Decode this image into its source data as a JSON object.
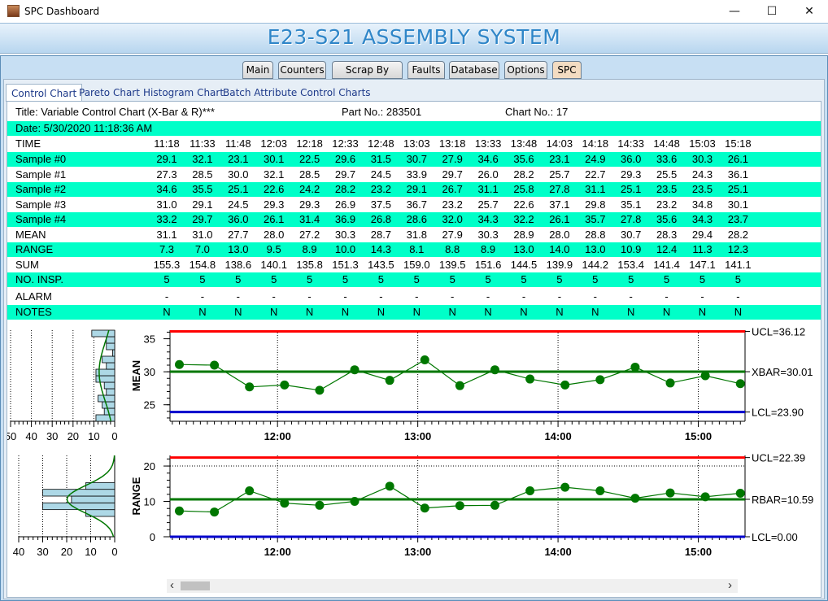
{
  "window": {
    "title": "SPC Dashboard",
    "minimize_glyph": "—",
    "maximize_glyph": "☐",
    "close_glyph": "✕"
  },
  "banner": {
    "title": "E23-S21 ASSEMBLY SYSTEM"
  },
  "main_tabs": [
    "Main",
    "Counters",
    "Scrap By Pallet",
    "Faults",
    "Database",
    "Options",
    "SPC"
  ],
  "main_tab_active": "SPC",
  "sub_tabs": [
    "Control Chart",
    "Pareto Chart",
    "Histogram Chart",
    "Batch Attribute Control Charts"
  ],
  "sub_tab_active": "Control Chart",
  "header": {
    "title": "Title: Variable Control Chart (X-Bar & R)***",
    "part_no": "Part No.: 283501",
    "chart_no": "Chart No.: 17",
    "date": "Date: 5/30/2020 11:18:36 AM"
  },
  "table": {
    "times": [
      "11:18",
      "11:33",
      "11:48",
      "12:03",
      "12:18",
      "12:33",
      "12:48",
      "13:03",
      "13:18",
      "13:33",
      "13:48",
      "14:03",
      "14:18",
      "14:33",
      "14:48",
      "15:03",
      "15:18"
    ],
    "rows": [
      {
        "label": "TIME",
        "key": "times",
        "hl": false
      },
      {
        "label": "Sample #0",
        "hl": true,
        "values": [
          "29.1",
          "32.1",
          "23.1",
          "30.1",
          "22.5",
          "29.6",
          "31.5",
          "30.7",
          "27.9",
          "34.6",
          "35.6",
          "23.1",
          "24.9",
          "36.0",
          "33.6",
          "30.3",
          "26.1"
        ]
      },
      {
        "label": "Sample #1",
        "hl": false,
        "values": [
          "27.3",
          "28.5",
          "30.0",
          "32.1",
          "28.5",
          "29.7",
          "24.5",
          "33.9",
          "29.7",
          "26.0",
          "28.2",
          "25.7",
          "22.7",
          "29.3",
          "25.5",
          "24.3",
          "36.1"
        ]
      },
      {
        "label": "Sample #2",
        "hl": true,
        "values": [
          "34.6",
          "35.5",
          "25.1",
          "22.6",
          "24.2",
          "28.2",
          "23.2",
          "29.1",
          "26.7",
          "31.1",
          "25.8",
          "27.8",
          "31.1",
          "25.1",
          "23.5",
          "23.5",
          "25.1"
        ]
      },
      {
        "label": "Sample #3",
        "hl": false,
        "values": [
          "31.0",
          "29.1",
          "24.5",
          "29.3",
          "29.3",
          "26.9",
          "37.5",
          "36.7",
          "23.2",
          "25.7",
          "22.6",
          "37.1",
          "29.8",
          "35.1",
          "23.2",
          "34.8",
          "30.1"
        ]
      },
      {
        "label": "Sample #4",
        "hl": true,
        "values": [
          "33.2",
          "29.7",
          "36.0",
          "26.1",
          "31.4",
          "36.9",
          "26.8",
          "28.6",
          "32.0",
          "34.3",
          "32.2",
          "26.1",
          "35.7",
          "27.8",
          "35.6",
          "34.3",
          "23.7"
        ]
      },
      {
        "label": "MEAN",
        "hl": false,
        "values": [
          "31.1",
          "31.0",
          "27.7",
          "28.0",
          "27.2",
          "30.3",
          "28.7",
          "31.8",
          "27.9",
          "30.3",
          "28.9",
          "28.0",
          "28.8",
          "30.7",
          "28.3",
          "29.4",
          "28.2"
        ]
      },
      {
        "label": "RANGE",
        "hl": true,
        "values": [
          "7.3",
          "7.0",
          "13.0",
          "9.5",
          "8.9",
          "10.0",
          "14.3",
          "8.1",
          "8.8",
          "8.9",
          "13.0",
          "14.0",
          "13.0",
          "10.9",
          "12.4",
          "11.3",
          "12.3"
        ]
      },
      {
        "label": "SUM",
        "hl": false,
        "values": [
          "155.3",
          "154.8",
          "138.6",
          "140.1",
          "135.8",
          "151.3",
          "143.5",
          "159.0",
          "139.5",
          "151.6",
          "144.5",
          "139.9",
          "144.2",
          "153.4",
          "141.4",
          "147.1",
          "141.1"
        ]
      },
      {
        "label": "NO. INSP.",
        "hl": true,
        "values": [
          "5",
          "5",
          "5",
          "5",
          "5",
          "5",
          "5",
          "5",
          "5",
          "5",
          "5",
          "5",
          "5",
          "5",
          "5",
          "5",
          "5"
        ]
      },
      {
        "label": "ALARM",
        "hl": false,
        "values": [
          "-",
          "-",
          "-",
          "-",
          "-",
          "-",
          "-",
          "-",
          "-",
          "-",
          "-",
          "-",
          "-",
          "-",
          "-",
          "-",
          "-"
        ]
      },
      {
        "label": "NOTES",
        "hl": true,
        "values": [
          "N",
          "N",
          "N",
          "N",
          "N",
          "N",
          "N",
          "N",
          "N",
          "N",
          "N",
          "N",
          "N",
          "N",
          "N",
          "N",
          "N"
        ]
      }
    ]
  },
  "chart_data": [
    {
      "type": "line",
      "ylabel": "MEAN",
      "ylim": [
        22.5,
        36.3
      ],
      "yticks": [
        "25",
        "30",
        "35"
      ],
      "xticks": [
        "12:00",
        "13:00",
        "14:00",
        "15:00"
      ],
      "x": [
        "11:18",
        "11:33",
        "11:48",
        "12:03",
        "12:18",
        "12:33",
        "12:48",
        "13:03",
        "13:18",
        "13:33",
        "13:48",
        "14:03",
        "14:18",
        "14:33",
        "14:48",
        "15:03",
        "15:18"
      ],
      "values": [
        31.1,
        31.0,
        27.7,
        28.0,
        27.2,
        30.3,
        28.7,
        31.8,
        27.9,
        30.3,
        28.9,
        28.0,
        28.8,
        30.7,
        28.3,
        29.4,
        28.2
      ],
      "limits": {
        "ucl": 36.12,
        "center": 30.01,
        "lcl": 23.9
      },
      "limit_labels": [
        "UCL=36.12",
        "XBAR=30.01",
        "LCL=23.90"
      ],
      "colors": {
        "ucl": "#ff0000",
        "center": "#007700",
        "lcl": "#0000cc",
        "series": "#007700"
      },
      "hist_xticks": [
        "50",
        "40",
        "30",
        "20",
        "10",
        "0"
      ]
    },
    {
      "type": "line",
      "ylabel": "RANGE",
      "ylim": [
        0,
        23
      ],
      "yticks": [
        "0",
        "10",
        "20"
      ],
      "xticks": [
        "12:00",
        "13:00",
        "14:00",
        "15:00"
      ],
      "x": [
        "11:18",
        "11:33",
        "11:48",
        "12:03",
        "12:18",
        "12:33",
        "12:48",
        "13:03",
        "13:18",
        "13:33",
        "13:48",
        "14:03",
        "14:18",
        "14:33",
        "14:48",
        "15:03",
        "15:18"
      ],
      "values": [
        7.3,
        7.0,
        13.0,
        9.5,
        8.9,
        10.0,
        14.3,
        8.1,
        8.8,
        8.9,
        13.0,
        14.0,
        13.0,
        10.9,
        12.4,
        11.3,
        12.3
      ],
      "limits": {
        "ucl": 22.39,
        "center": 10.59,
        "lcl": 0.0
      },
      "limit_labels": [
        "UCL=22.39",
        "RBAR=10.59",
        "LCL=0.00"
      ],
      "colors": {
        "ucl": "#ff0000",
        "center": "#007700",
        "lcl": "#0000cc",
        "series": "#007700"
      },
      "hist_xticks": [
        "40",
        "30",
        "20",
        "10",
        "0"
      ]
    }
  ],
  "scrollbar": {
    "left_arrow": "‹",
    "right_arrow": "›"
  }
}
